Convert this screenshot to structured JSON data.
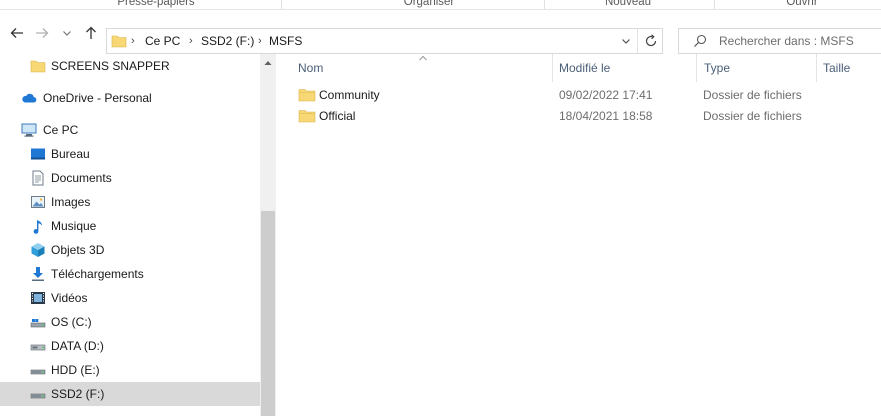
{
  "ribbon": {
    "groups": [
      "Presse-papiers",
      "Organiser",
      "Nouveau",
      "Ouvrir"
    ]
  },
  "nav": {
    "back_icon": "arrow-left-icon",
    "forward_icon": "arrow-right-icon",
    "recent_icon": "chevron-down-icon",
    "up_icon": "arrow-up-icon",
    "breadcrumb": [
      "Ce PC",
      "SSD2 (F:)",
      "MSFS"
    ],
    "refresh_icon": "refresh-icon",
    "search_placeholder": "Rechercher dans : MSFS"
  },
  "sidebar": {
    "items": [
      {
        "label": "SCREENS SNAPPER",
        "icon": "folder-icon"
      },
      {
        "label": "OneDrive - Personal",
        "icon": "cloud-icon"
      },
      {
        "label": "Ce PC",
        "icon": "computer-icon"
      },
      {
        "label": "Bureau",
        "icon": "desktop-icon"
      },
      {
        "label": "Documents",
        "icon": "document-icon"
      },
      {
        "label": "Images",
        "icon": "pictures-icon"
      },
      {
        "label": "Musique",
        "icon": "music-icon"
      },
      {
        "label": "Objets 3D",
        "icon": "cube-icon"
      },
      {
        "label": "Téléchargements",
        "icon": "download-icon"
      },
      {
        "label": "Vidéos",
        "icon": "video-icon"
      },
      {
        "label": "OS (C:)",
        "icon": "drive-icon"
      },
      {
        "label": "DATA (D:)",
        "icon": "drive-icon"
      },
      {
        "label": "HDD (E:)",
        "icon": "drive-icon"
      },
      {
        "label": "SSD2 (F:)",
        "icon": "drive-icon"
      }
    ],
    "selected": "SSD2 (F:)"
  },
  "content": {
    "columns": [
      "Nom",
      "Modifié le",
      "Type",
      "Taille"
    ],
    "rows": [
      {
        "name": "Community",
        "modified": "09/02/2022 17:41",
        "type": "Dossier de fichiers",
        "size": ""
      },
      {
        "name": "Official",
        "modified": "18/04/2021 18:58",
        "type": "Dossier de fichiers",
        "size": ""
      }
    ]
  },
  "colors": {
    "folder": "#f8d775",
    "header_text": "#4c607a",
    "selection": "#d9d9d9"
  }
}
